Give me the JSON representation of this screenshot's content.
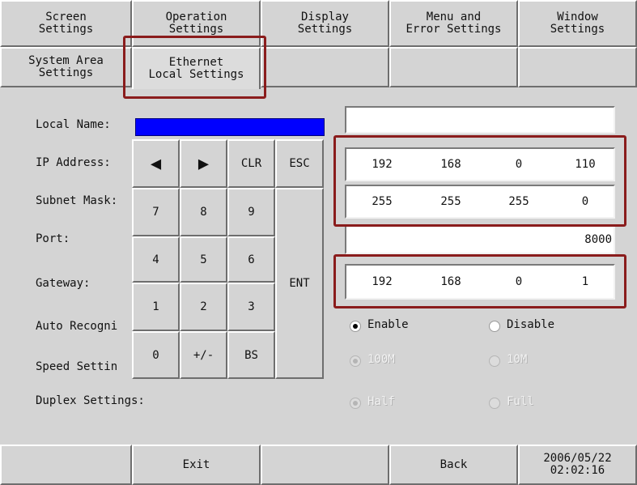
{
  "tabs_row1": [
    "Screen\nSettings",
    "Operation\nSettings",
    "Display\nSettings",
    "Menu and\nError Settings",
    "Window\nSettings"
  ],
  "tabs_row2": [
    "System Area\nSettings",
    "Ethernet\nLocal Settings",
    "",
    "",
    ""
  ],
  "labels": {
    "local_name": "Local Name:",
    "ip_address": "IP Address:",
    "subnet_mask": "Subnet Mask:",
    "port": "Port:",
    "gateway": "Gateway:",
    "auto_recognition": "Auto Recogni",
    "speed_setting": "Speed Settin",
    "duplex_settings": "Duplex Settings:"
  },
  "values": {
    "local_name": "",
    "ip_address": [
      "192",
      "168",
      "0",
      "110"
    ],
    "subnet_mask": [
      "255",
      "255",
      "255",
      "0"
    ],
    "port": "8000",
    "gateway": [
      "192",
      "168",
      "0",
      "1"
    ]
  },
  "keypad": {
    "left_arrow": "◀",
    "right_arrow": "▶",
    "clr": "CLR",
    "esc": "ESC",
    "k7": "7",
    "k8": "8",
    "k9": "9",
    "k4": "4",
    "k5": "5",
    "k6": "6",
    "k1": "1",
    "k2": "2",
    "k3": "3",
    "k0": "0",
    "plusminus": "+/-",
    "bs": "BS",
    "ent": "ENT"
  },
  "radios": {
    "auto_enable": "Enable",
    "auto_disable": "Disable",
    "speed_100": "100M",
    "speed_10": "10M",
    "duplex_half": "Half",
    "duplex_full": "Full"
  },
  "bottom": {
    "exit": "Exit",
    "back": "Back",
    "date": "2006/05/22",
    "time": "02:02:16"
  },
  "colors": {
    "panel": "#d4d4d4",
    "input_active": "#0000ff",
    "highlight": "#8a1c1c"
  }
}
